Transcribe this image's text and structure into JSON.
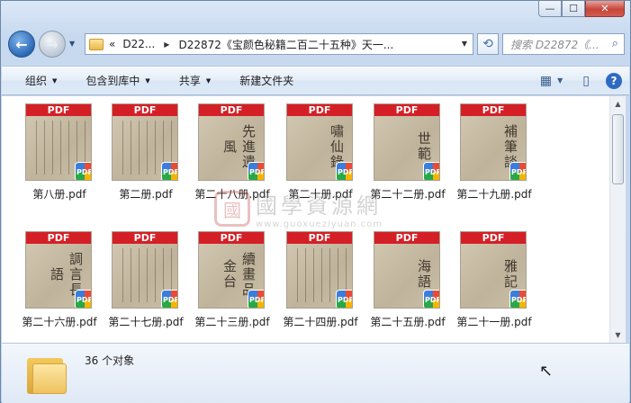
{
  "window": {
    "minimize_glyph": "—",
    "maximize_glyph": "☐",
    "close_glyph": "✕"
  },
  "nav": {
    "back_glyph": "←",
    "forward_glyph": "→",
    "address_prefix": "«",
    "address_part1": "D22...",
    "address_sep": "▶",
    "address_part2": "D22872《宝颜色秘籍二百二十五种》天一...",
    "refresh_glyph": "⟲",
    "search_placeholder": "搜索 D22872《...",
    "search_icon": "⌕"
  },
  "toolbar": {
    "organize": "组织",
    "include_in_library": "包含到库中",
    "share": "共享",
    "new_folder": "新建文件夹",
    "view_icon": "▦",
    "pane_icon": "▯",
    "help_label": "?"
  },
  "files": [
    {
      "name": "第八册.pdf",
      "cover": ""
    },
    {
      "name": "第二册.pdf",
      "cover": ""
    },
    {
      "name": "第二十八册.pdf",
      "cover": "先進遺風"
    },
    {
      "name": "第二十册.pdf",
      "cover": "嘯仙錄"
    },
    {
      "name": "第二十二册.pdf",
      "cover": "世範"
    },
    {
      "name": "第二十九册.pdf",
      "cover": "補筆談"
    },
    {
      "name": "第二十六册.pdf",
      "cover": "調言長語"
    },
    {
      "name": "第二十七册.pdf",
      "cover": ""
    },
    {
      "name": "第二十三册.pdf",
      "cover": "續畫品 金台"
    },
    {
      "name": "第二十四册.pdf",
      "cover": ""
    },
    {
      "name": "第二十五册.pdf",
      "cover": "海語"
    },
    {
      "name": "第二十一册.pdf",
      "cover": "雅記"
    }
  ],
  "pdf_band_label": "PDF",
  "pdf_badge_label": "PDF",
  "watermark": {
    "seal": "國",
    "name": "國學資源網",
    "url": "www.guoxueziyuan.com"
  },
  "status": {
    "count_text": "36 个对象",
    "cursor_glyph": "↖"
  },
  "colors": {
    "pdf_red": "#d51f26",
    "chrome_blue": "#c7d9ef"
  }
}
